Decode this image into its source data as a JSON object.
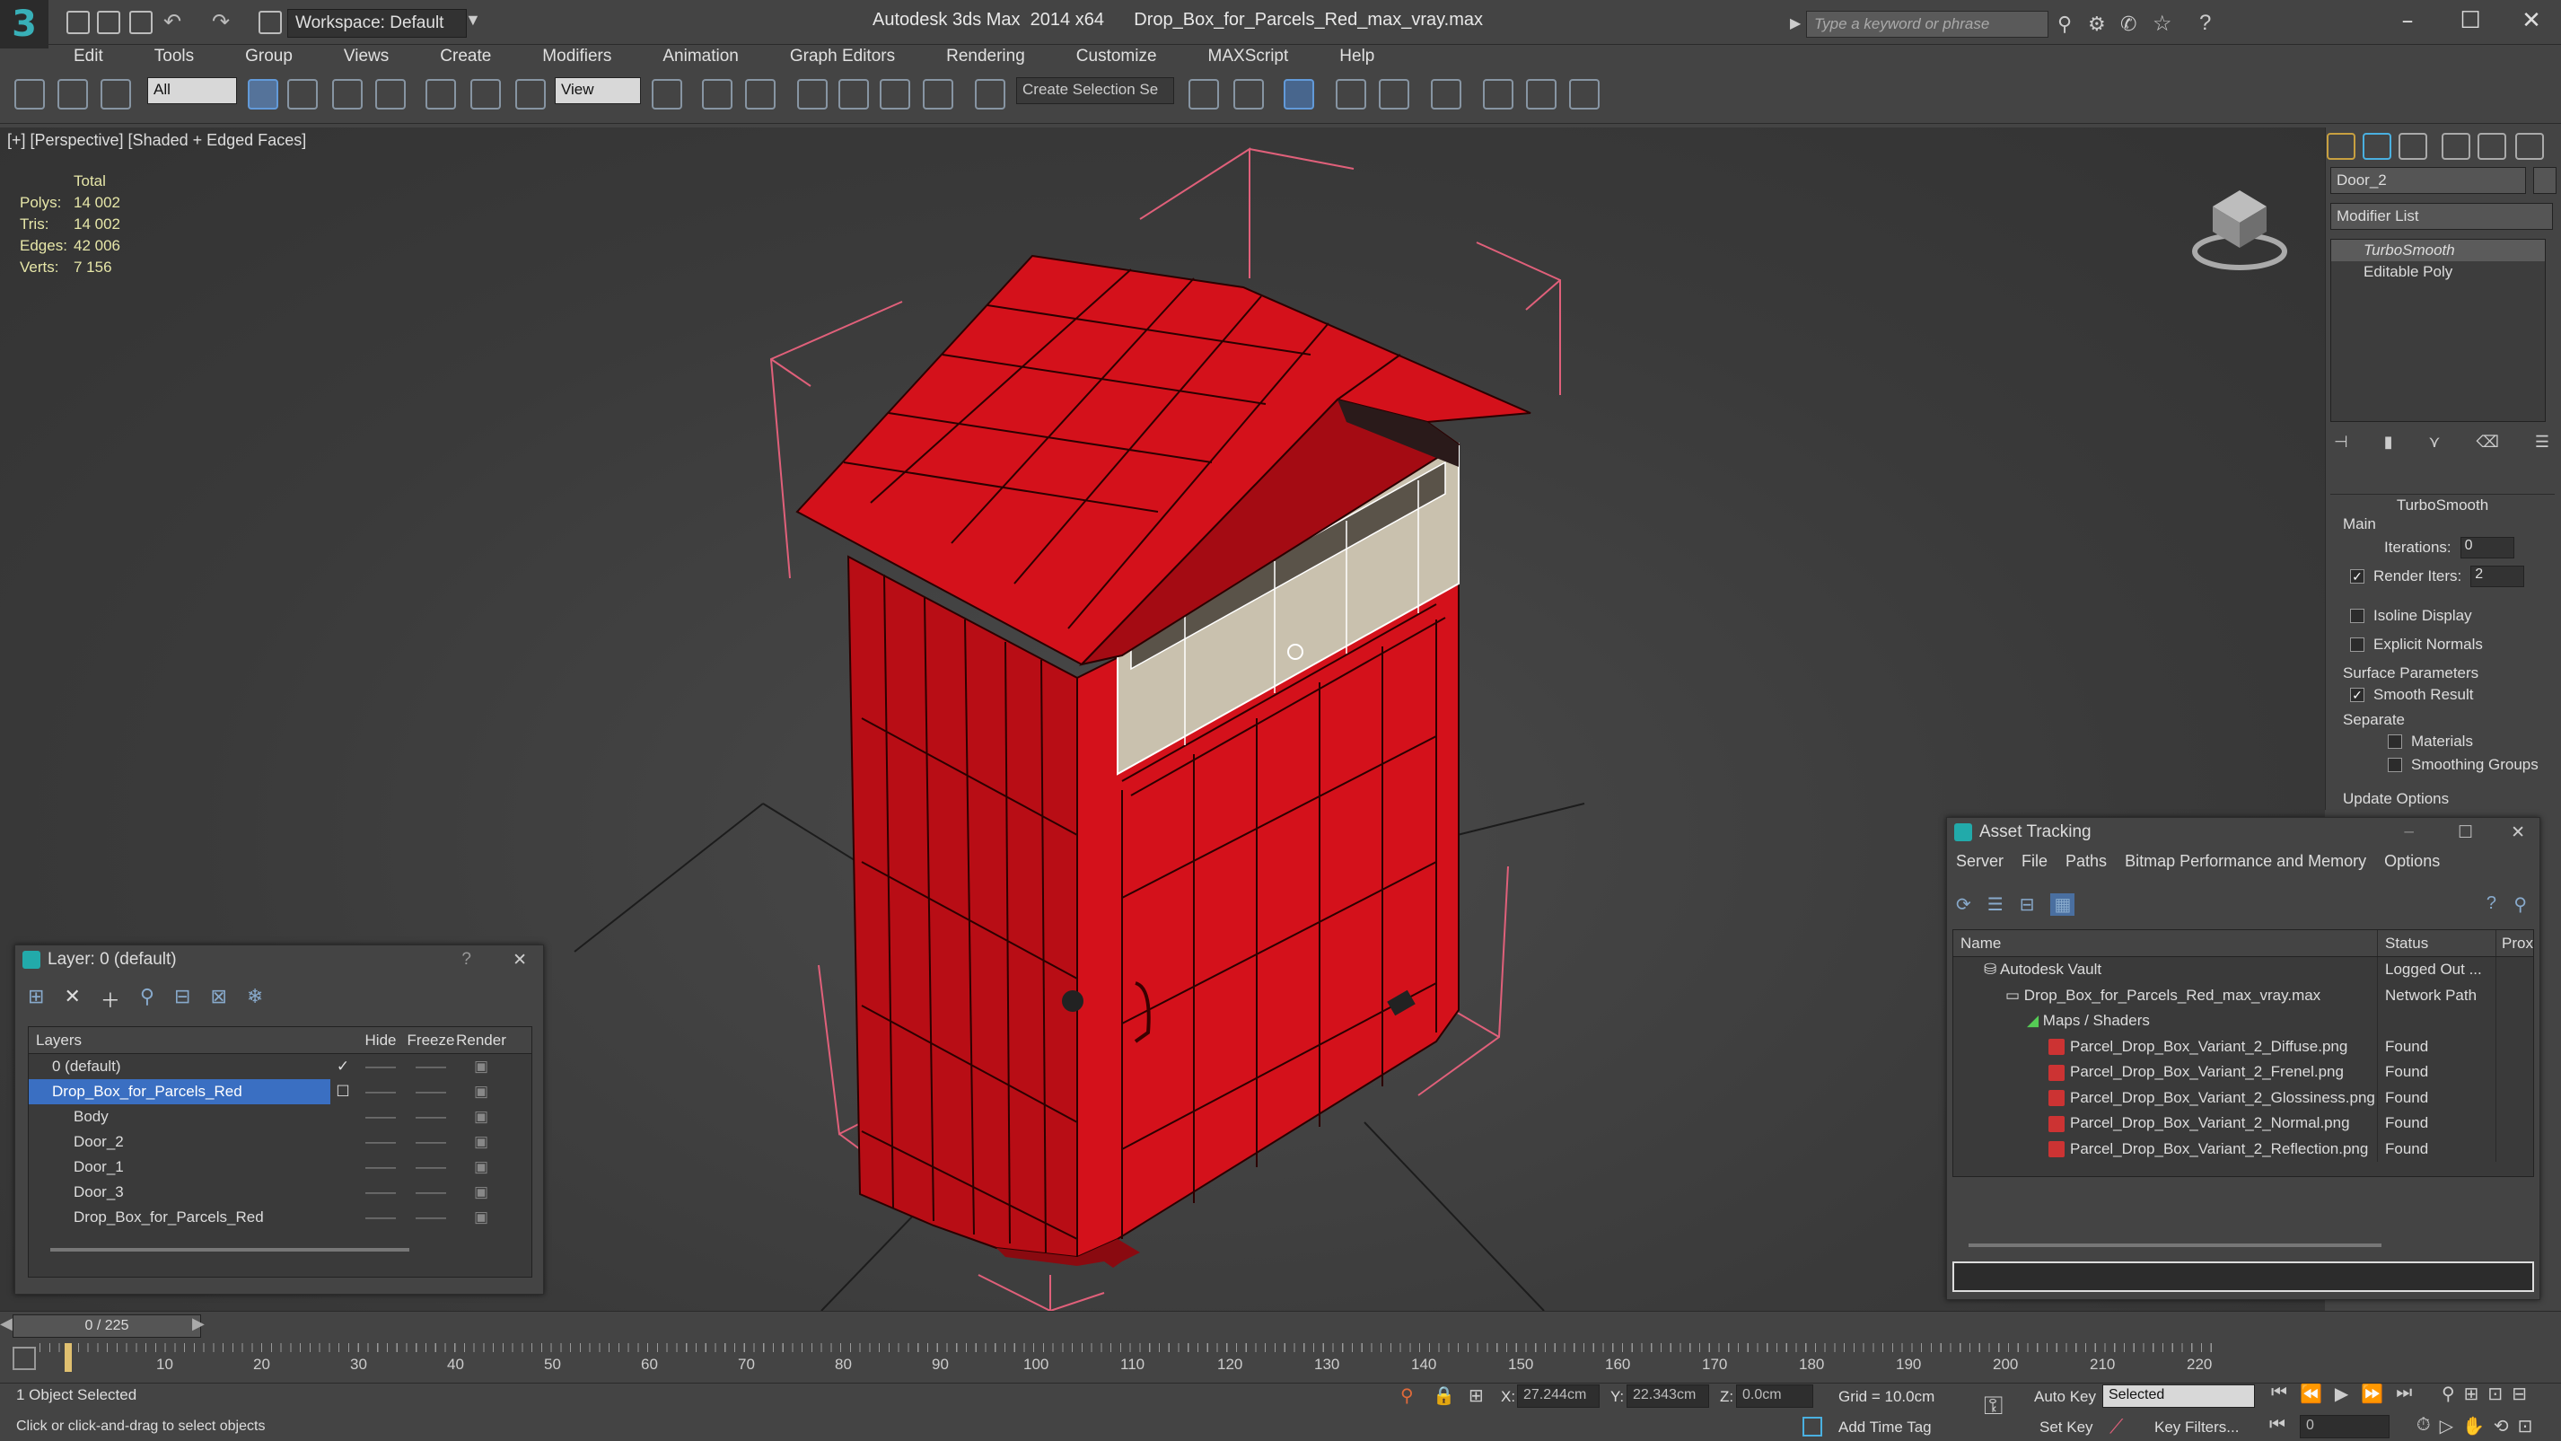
{
  "app": {
    "title": "Autodesk 3ds Max  2014 x64      Drop_Box_for_Parcels_Red_max_vray.max",
    "logo": "3",
    "workspace": "Workspace: Default",
    "search_placeholder": "Type a keyword or phrase"
  },
  "menu": [
    "Edit",
    "Tools",
    "Group",
    "Views",
    "Create",
    "Modifiers",
    "Animation",
    "Graph Editors",
    "Rendering",
    "Customize",
    "MAXScript",
    "Help"
  ],
  "toolbar": {
    "selection_filter": "All",
    "ref_coord": "View",
    "named_selection": "Create Selection Se"
  },
  "viewport": {
    "label": "[+] [Perspective] [Shaded + Edged Faces]",
    "stats": {
      "header": "Total",
      "rows": [
        {
          "label": "Polys:",
          "value": "14 002"
        },
        {
          "label": "Tris:",
          "value": "14 002"
        },
        {
          "label": "Edges:",
          "value": "42 006"
        },
        {
          "label": "Verts:",
          "value": "7 156"
        }
      ]
    }
  },
  "command_panel": {
    "object_name": "Door_2",
    "modifier_list": "Modifier List",
    "stack": [
      "TurboSmooth",
      "Editable Poly"
    ],
    "rollout_title": "TurboSmooth",
    "main_label": "Main",
    "iterations_label": "Iterations:",
    "iterations_value": "0",
    "render_iters_label": "Render Iters:",
    "render_iters_value": "2",
    "isoline": "Isoline Display",
    "explicit_normals": "Explicit Normals",
    "surface_params": "Surface Parameters",
    "smooth_result": "Smooth Result",
    "separate": "Separate",
    "materials": "Materials",
    "smoothing_groups": "Smoothing Groups",
    "update_options": "Update Options"
  },
  "layer_window": {
    "title": "Layer: 0 (default)",
    "help": "?",
    "close": "✕",
    "headers": [
      "Layers",
      "Hide",
      "Freeze",
      "Render"
    ],
    "rows": [
      {
        "name": "0 (default)",
        "indent": 1
      },
      {
        "name": "Drop_Box_for_Parcels_Red",
        "indent": 1,
        "selected": true
      },
      {
        "name": "Body",
        "indent": 2
      },
      {
        "name": "Door_2",
        "indent": 2
      },
      {
        "name": "Door_1",
        "indent": 2
      },
      {
        "name": "Door_3",
        "indent": 2
      },
      {
        "name": "Drop_Box_for_Parcels_Red",
        "indent": 2
      }
    ]
  },
  "asset_window": {
    "title": "Asset Tracking",
    "menu": [
      "Server",
      "File",
      "Paths",
      "Bitmap Performance and Memory",
      "Options"
    ],
    "headers": [
      "Name",
      "Status",
      "Prox"
    ],
    "rows": [
      {
        "name": "Autodesk Vault",
        "status": "Logged Out ...",
        "indent": 1
      },
      {
        "name": "Drop_Box_for_Parcels_Red_max_vray.max",
        "status": "Network Path",
        "indent": 2
      },
      {
        "name": "Maps / Shaders",
        "status": "",
        "indent": 3
      },
      {
        "name": "Parcel_Drop_Box_Variant_2_Diffuse.png",
        "status": "Found",
        "indent": 4
      },
      {
        "name": "Parcel_Drop_Box_Variant_2_Frenel.png",
        "status": "Found",
        "indent": 4
      },
      {
        "name": "Parcel_Drop_Box_Variant_2_Glossiness.png",
        "status": "Found",
        "indent": 4
      },
      {
        "name": "Parcel_Drop_Box_Variant_2_Normal.png",
        "status": "Found",
        "indent": 4
      },
      {
        "name": "Parcel_Drop_Box_Variant_2_Reflection.png",
        "status": "Found",
        "indent": 4
      }
    ]
  },
  "timeline": {
    "frame": "0 / 225",
    "ticks": [
      "10",
      "20",
      "30",
      "40",
      "50",
      "60",
      "70",
      "80",
      "90",
      "100",
      "110",
      "120",
      "130",
      "140",
      "150",
      "160",
      "170",
      "180",
      "190",
      "200",
      "210",
      "220"
    ]
  },
  "status": {
    "selected": "1 Object Selected",
    "prompt": "Click or click-and-drag to select objects",
    "x_label": "X:",
    "x": "27.244cm",
    "y_label": "Y:",
    "y": "22.343cm",
    "z_label": "Z:",
    "z": "0.0cm",
    "grid": "Grid = 10.0cm",
    "auto_key": "Auto Key",
    "set_key": "Set Key",
    "key_mode": "Selected",
    "key_filters": "Key Filters...",
    "add_time_tag": "Add Time Tag",
    "frame_field": "0"
  },
  "colors": {
    "box_red": "#d4111b",
    "selection_blue": "#3a6fc2",
    "stats_yellow": "#e6e6a8"
  }
}
